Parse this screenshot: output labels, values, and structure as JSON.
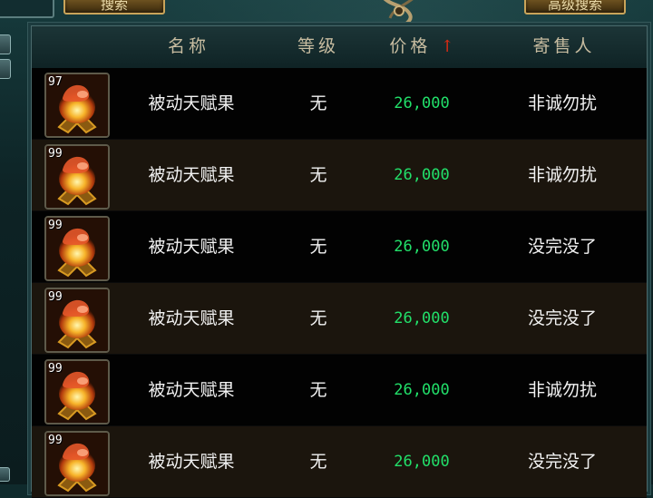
{
  "toolbar": {
    "search_label": "搜索",
    "advanced_search_label": "高级搜索"
  },
  "table": {
    "columns": {
      "name": "名称",
      "level": "等级",
      "price": "价格",
      "seller": "寄售人"
    },
    "sort_indicator": "↑",
    "rows": [
      {
        "qty": "97",
        "name": "被动天赋果",
        "level": "无",
        "price": "26,000",
        "seller": "非诚勿扰"
      },
      {
        "qty": "99",
        "name": "被动天赋果",
        "level": "无",
        "price": "26,000",
        "seller": "非诚勿扰"
      },
      {
        "qty": "99",
        "name": "被动天赋果",
        "level": "无",
        "price": "26,000",
        "seller": "没完没了"
      },
      {
        "qty": "99",
        "name": "被动天赋果",
        "level": "无",
        "price": "26,000",
        "seller": "没完没了"
      },
      {
        "qty": "99",
        "name": "被动天赋果",
        "level": "无",
        "price": "26,000",
        "seller": "非诚勿扰"
      },
      {
        "qty": "99",
        "name": "被动天赋果",
        "level": "无",
        "price": "26,000",
        "seller": "没完没了"
      }
    ]
  },
  "colors": {
    "price": "#22e06a",
    "sort_arrow": "#e02a12",
    "header_text": "#c7bca0"
  },
  "icons": {
    "item": "talent-fruit-icon",
    "ornament": "dragon-ornament-icon"
  }
}
